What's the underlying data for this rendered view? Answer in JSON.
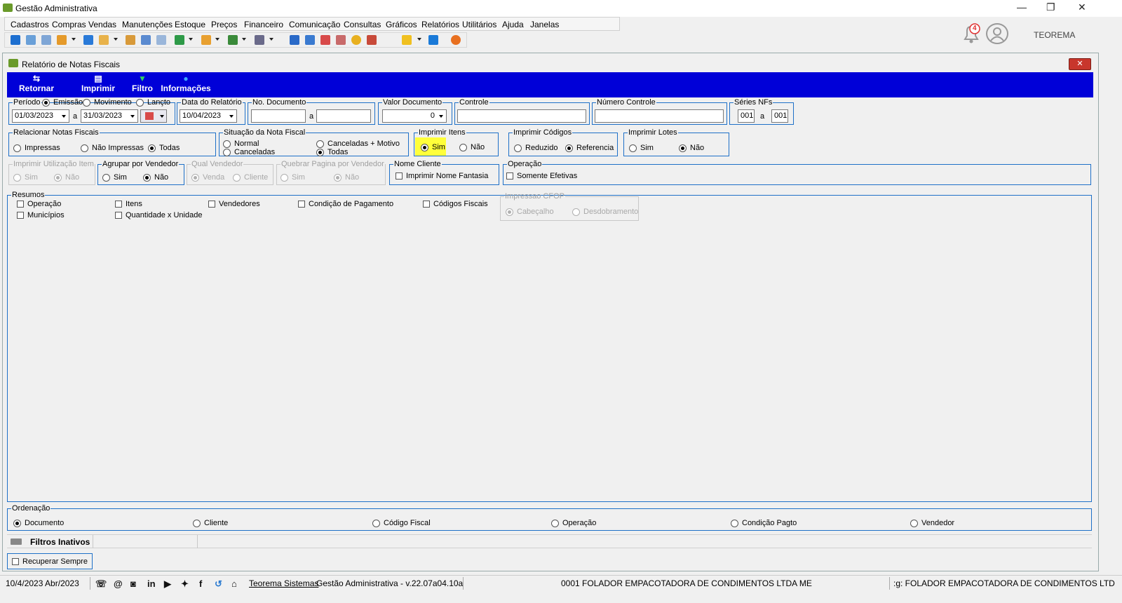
{
  "window": {
    "title": "Gestão Administrativa"
  },
  "menu": [
    "Cadastros",
    "Compras",
    "Vendas",
    "Manutenções",
    "Estoque",
    "Preços",
    "Financeiro",
    "Comunicação",
    "Consultas",
    "Gráficos",
    "Relatórios",
    "Utilitários",
    "Ajuda",
    "Janelas"
  ],
  "header": {
    "notifications": "4",
    "brand": "TEOREMA"
  },
  "child": {
    "title": "Relatório de Notas Fiscais",
    "close": "✕"
  },
  "actions": [
    {
      "label": "Retornar",
      "icon": "⇆"
    },
    {
      "label": "Imprimir",
      "icon": "▤"
    },
    {
      "label": "Filtro",
      "icon": "▼"
    },
    {
      "label": "Informações",
      "icon": "●"
    }
  ],
  "periodo": {
    "legend": "Período",
    "opt_emissao": "Emissão",
    "opt_movimento": "Movimento",
    "opt_lancto": "Lançto",
    "de": "01/03/2023",
    "a_label": "a",
    "ate": "31/03/2023"
  },
  "data_relatorio": {
    "legend": "Data do Relatório",
    "value": "10/04/2023"
  },
  "no_documento": {
    "legend": "No. Documento",
    "a_label": "a",
    "de": "",
    "ate": ""
  },
  "valor_documento": {
    "legend": "Valor Documento",
    "value": "0"
  },
  "controle": {
    "legend": "Controle",
    "value": ""
  },
  "numero_controle": {
    "legend": "Número Controle",
    "value": ""
  },
  "series": {
    "legend": "Séries NFs",
    "de": "001",
    "a_label": "a",
    "ate": "001"
  },
  "relacionar": {
    "legend": "Relacionar Notas Fiscais",
    "opts": [
      "Impressas",
      "Não Impressas",
      "Todas"
    ]
  },
  "situacao": {
    "legend": "Situação da Nota Fiscal",
    "opts": [
      "Normal",
      "Canceladas",
      "Canceladas + Motivo",
      "Todas"
    ]
  },
  "imprimir_itens": {
    "legend": "Imprimir Itens",
    "opts": [
      "Sim",
      "Não"
    ]
  },
  "imprimir_codigos": {
    "legend": "Imprimir Códigos",
    "opts": [
      "Reduzido",
      "Referencia"
    ]
  },
  "imprimir_lotes": {
    "legend": "Imprimir Lotes",
    "opts": [
      "Sim",
      "Não"
    ]
  },
  "imprimir_utilizacao": {
    "legend": "Imprimir Utilização Item",
    "opts": [
      "Sim",
      "Não"
    ]
  },
  "agrupar_vendedor": {
    "legend": "Agrupar por Vendedor",
    "opts": [
      "Sim",
      "Não"
    ]
  },
  "qual_vendedor": {
    "legend": "Qual Vendedor",
    "opts": [
      "Venda",
      "Cliente"
    ]
  },
  "quebrar_pagina": {
    "legend": "Quebrar Pagina por Vendedor",
    "opts": [
      "Sim",
      "Não"
    ]
  },
  "nome_cliente": {
    "legend": "Nome Cliente",
    "opt": "Imprimir Nome Fantasia"
  },
  "operacao": {
    "legend": "Operação",
    "opt": "Somente Efetivas"
  },
  "resumos": {
    "legend": "Resumos",
    "items": [
      "Operação",
      "Municípios",
      "Itens",
      "Quantidade x Unidade",
      "Vendedores",
      "Condição de Pagamento",
      "Códigos Fiscais"
    ]
  },
  "impressao_cfop": {
    "legend": "Impressao CFOP",
    "opts": [
      "Cabeçalho",
      "Desdobramento"
    ]
  },
  "ordenacao": {
    "legend": "Ordenação",
    "opts": [
      "Documento",
      "Cliente",
      "Código Fiscal",
      "Operação",
      "Condição Pagto",
      "Vendedor"
    ]
  },
  "filtros": {
    "label": "Filtros Inativos",
    "recuperar": "Recuperar Sempre"
  },
  "status": {
    "date": "10/4/2023 Abr/2023",
    "link": "Teorema Sistemas",
    "version": "Gestão Administrativa - v.22.07a04.10a",
    "company": "0001 FOLADOR EMPACOTADORA DE CONDIMENTOS LTDA ME",
    "company_cut": ":g: FOLADOR EMPACOTADORA DE CONDIMENTOS LTD"
  },
  "accent": {
    "blue_bar": "#0000d8",
    "frame": "#1e70c8",
    "highlight": "#ffff3a"
  }
}
